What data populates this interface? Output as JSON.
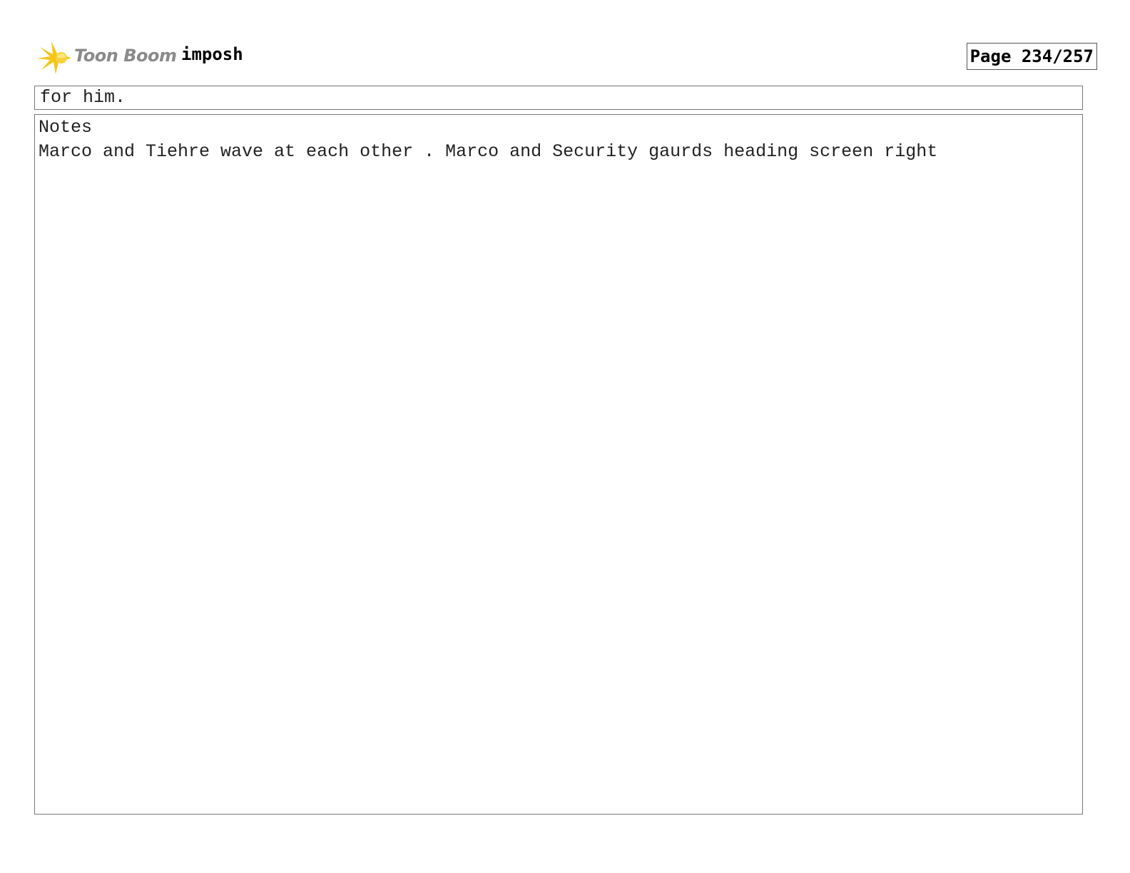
{
  "header": {
    "logo_text": "Toon Boom",
    "project_title": "imposh",
    "page_number": "Page 234/257"
  },
  "dialogue": {
    "text": "for him."
  },
  "notes": {
    "label": "Notes",
    "text": "Marco and Tiehre wave at each other . Marco and Security gaurds heading screen right"
  },
  "colors": {
    "logo_yellow": "#f5c518",
    "logo_gray": "#8a8a8a",
    "border": "#777777"
  }
}
